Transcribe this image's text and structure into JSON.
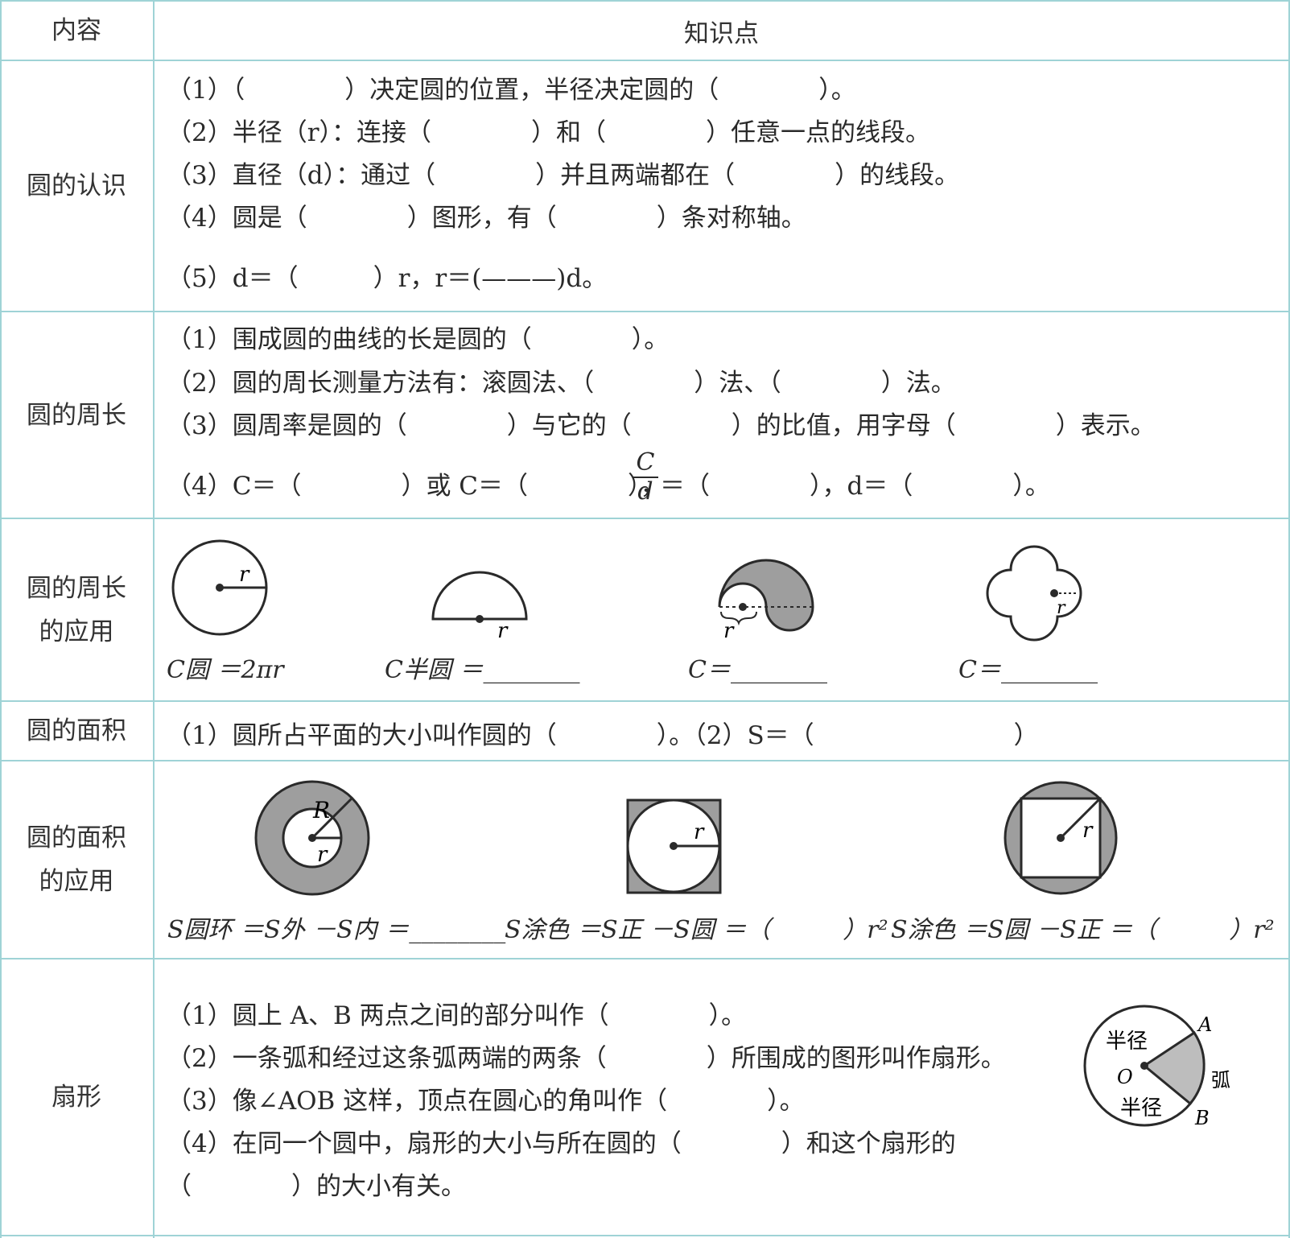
{
  "header": {
    "col1": "内容",
    "col2": "知识点"
  },
  "rows": {
    "r1": {
      "category": "圆的认识",
      "lines": [
        "（1）（　　　　）决定圆的位置，半径决定圆的（　　　　）。",
        "（2）半径（r）：连接（　　　　）和（　　　　）任意一点的线段。",
        "（3）直径（d）：通过（　　　　）并且两端都在（　　　　）的线段。",
        "（4）圆是（　　　　）图形，有（　　　　）条对称轴。",
        "（5）d＝（　　　）r，r＝(———)d。"
      ]
    },
    "r2": {
      "category": "圆的周长",
      "lines": [
        "（1）围成圆的曲线的长是圆的（　　　　）。",
        "（2）圆的周长测量方法有：滚圆法、（　　　　）法、（　　　　）法。",
        "（3）圆周率是圆的（　　　　）与它的（　　　　）的比值，用字母（　　　　）表示。",
        "（4）C＝（　　　　）或 C＝（　　　　），",
        "＝（　　　　），d＝（　　　　）。"
      ],
      "fraction_num": "C",
      "fraction_den": "d"
    },
    "r3": {
      "category_line1": "圆的周长",
      "category_line2": "的应用",
      "labels": [
        "C圆 ＝2πr",
        "C半圆 ＝________",
        "C＝________",
        "C＝________"
      ],
      "r_label": "r"
    },
    "r4": {
      "category": "圆的面积",
      "line": "（1）圆所占平面的大小叫作圆的（　　　　）。（2）S＝（　　　　　　　　）"
    },
    "r5": {
      "category_line1": "圆的面积",
      "category_line2": "的应用",
      "labels": [
        "S圆环 ＝S外 －S内 ＝________",
        "S涂色 ＝S正 －S圆 ＝（　　　）r²",
        "S涂色 ＝S圆 －S正 ＝（　　　）r²"
      ],
      "R_label": "R",
      "r_label": "r"
    },
    "r6": {
      "category": "扇形",
      "lines": [
        "（1）圆上 A、B 两点之间的部分叫作（　　　　）。",
        "（2）一条弧和经过这条弧两端的两条（　　　　）所围成的图形叫作扇形。",
        "（3）像∠AOB 这样，顶点在圆心的角叫作（　　　　）。",
        "（4）在同一个圆中，扇形的大小与所在圆的（　　　　）和这个扇形的",
        "（　　　　）的大小有关。"
      ],
      "diagram": {
        "radius1": "半径",
        "radius2": "半径",
        "center": "O",
        "arc": "弧",
        "pointA": "A",
        "pointB": "B"
      }
    }
  },
  "colors": {
    "grid": "#9fd3d6",
    "shade": "#bdbdbd",
    "ink": "#2a2a2a"
  }
}
